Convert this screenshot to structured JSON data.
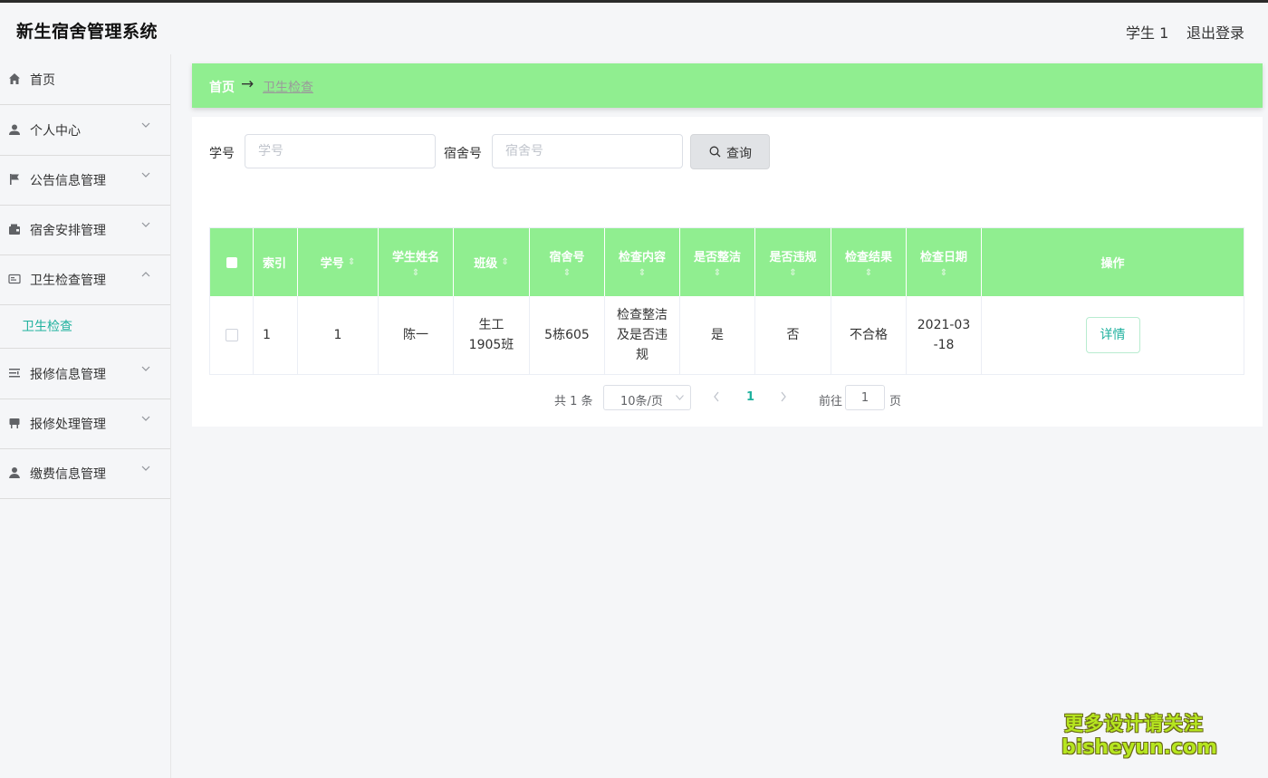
{
  "header": {
    "app_title": "新生宿舍管理系统",
    "user_name": "学生 1",
    "logout": "退出登录"
  },
  "sidebar": {
    "items": [
      {
        "label": "首页",
        "icon": "home-icon"
      },
      {
        "label": "个人中心",
        "icon": "user-icon"
      },
      {
        "label": "公告信息管理",
        "icon": "flag-icon"
      },
      {
        "label": "宿舍安排管理",
        "icon": "wallet-icon"
      },
      {
        "label": "卫生检查管理",
        "icon": "card-icon",
        "expanded": true
      },
      {
        "label": "报修信息管理",
        "icon": "list-icon"
      },
      {
        "label": "报修处理管理",
        "icon": "chair-icon"
      },
      {
        "label": "缴费信息管理",
        "icon": "person-icon"
      }
    ],
    "submenu_active": "卫生检查"
  },
  "breadcrumb": {
    "home": "首页",
    "arrow": "→",
    "current": "卫生检查"
  },
  "search": {
    "student_id_label": "学号",
    "student_id_placeholder": "学号",
    "dorm_label": "宿舍号",
    "dorm_placeholder": "宿舍号",
    "button_label": "查询"
  },
  "table": {
    "columns": {
      "index": "索引",
      "student_id": "学号",
      "student_name": "学生姓名",
      "class": "班级",
      "dorm": "宿舍号",
      "content": "检查内容",
      "clean": "是否整洁",
      "violation": "是否违规",
      "result": "检查结果",
      "date": "检查日期",
      "action": "操作"
    },
    "sort_glyph": "⇕",
    "rows": [
      {
        "index": "1",
        "student_id": "1",
        "student_name": "陈一",
        "class": "生工1905班",
        "dorm": "5栋605",
        "content": "检查整洁及是否违规",
        "clean": "是",
        "violation": "否",
        "result": "不合格",
        "date": "2021-03-18",
        "action": "详情"
      }
    ]
  },
  "pagination": {
    "total": "共 1 条",
    "page_size": "10条/页",
    "current_page": "1",
    "goto_label": "前往",
    "goto_value": "1",
    "goto_unit": "页"
  },
  "watermark": {
    "line1": "更多设计请关注",
    "line2": "bisheyun.com"
  },
  "colors": {
    "accent_green": "#90ee90",
    "active_teal": "#1fb19e"
  }
}
